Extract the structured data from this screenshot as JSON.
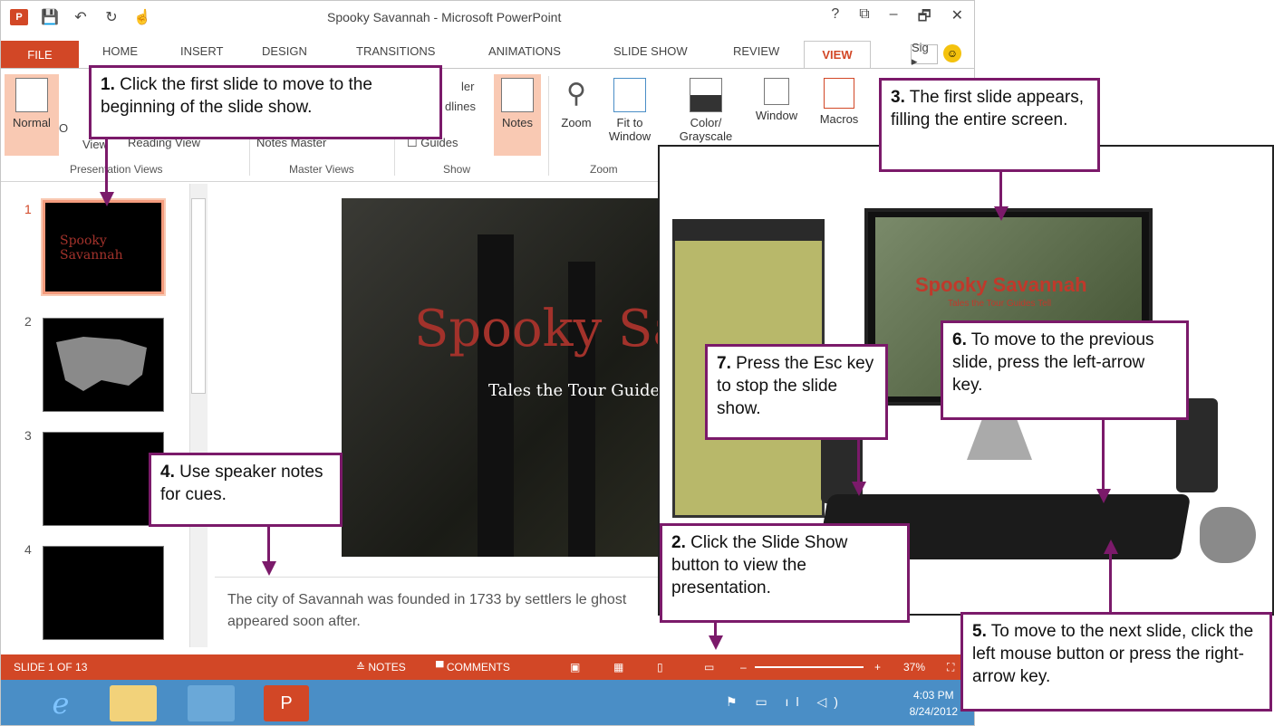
{
  "window": {
    "title": "Spooky Savannah - Microsoft PowerPoint",
    "ctrls": [
      "?",
      "⧉",
      "–",
      "🗗",
      "✕"
    ]
  },
  "qat": {
    "logo": "P",
    "save": "💾",
    "undo": "↶",
    "redo": "↻",
    "touch": "☝"
  },
  "tabs": {
    "file": "FILE",
    "home": "HOME",
    "insert": "INSERT",
    "design": "DESIGN",
    "transitions": "TRANSITIONS",
    "animations": "ANIMATIONS",
    "slideshow": "SLIDE SHOW",
    "review": "REVIEW",
    "view": "VIEW",
    "sig": "Sig ▸"
  },
  "ribbon": {
    "normal": "Normal",
    "outline": "O",
    "view": "View",
    "reading_view": "Reading View",
    "notes_master": "Notes Master",
    "ruler": "ler",
    "gridlines": "dlines",
    "guides": "Guides",
    "notes": "Notes",
    "zoom": "Zoom",
    "fit": "Fit to",
    "window_label": "Window",
    "color": "Color/",
    "grayscale": "Grayscale",
    "window": "Window",
    "macros": "Macros",
    "groups": {
      "presentation_views": "Presentation Views",
      "master_views": "Master Views",
      "show": "Show",
      "zoom": "Zoom"
    }
  },
  "slides": {
    "numbers": [
      "1",
      "2",
      "3",
      "4"
    ]
  },
  "main_slide": {
    "title": "Spooky Sava",
    "subtitle": "Tales the Tour Guides T"
  },
  "notes_text": "The city of Savannah was founded in 1733 by settlers le ghost appeared soon after.",
  "status": {
    "slide": "SLIDE 1 OF 13",
    "notes": "≙ NOTES",
    "comments": "▀ COMMENTS",
    "zoom": "37%",
    "minus": "–",
    "plus": "+"
  },
  "taskbar": {
    "time": "4:03 PM",
    "date": "8/24/2012",
    "tray": "⚑ ▭ ıl ◁)"
  },
  "photo": {
    "title": "Spooky Savannah",
    "subtitle": "Tales the Tour Guides Tell"
  },
  "callouts": {
    "c1_num": "1.",
    "c1_text": " Click the first slide to move to the beginning of the slide show.",
    "c2_num": "2.",
    "c2_text": " Click the Slide Show button to view the presentation.",
    "c3_num": "3.",
    "c3_text": " The first slide appears, filling the entire screen.",
    "c4_num": "4.",
    "c4_text": " Use speaker notes for cues.",
    "c5_num": "5.",
    "c5_text": " To move to the next slide, click the left mouse button or press the right-arrow key.",
    "c6_num": "6.",
    "c6_text": " To move to the previous slide, press the left-arrow key.",
    "c7_num": "7.",
    "c7_text": " Press the Esc key to stop the slide show."
  }
}
